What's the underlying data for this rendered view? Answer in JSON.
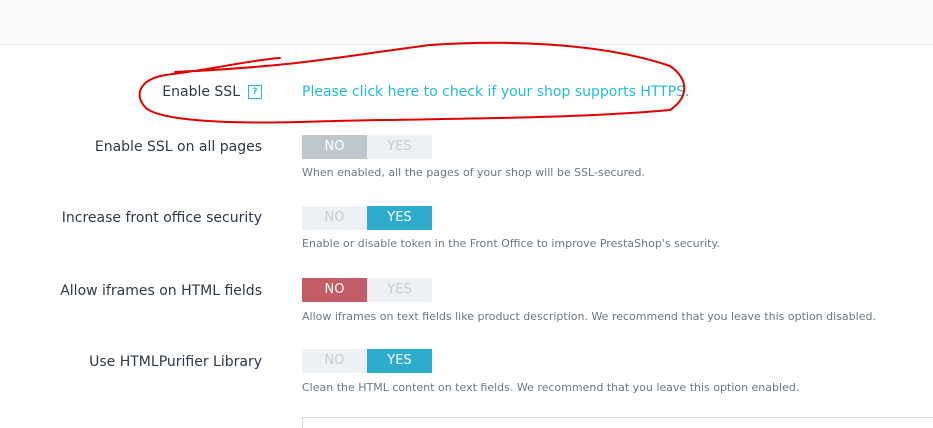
{
  "ssl": {
    "label": "Enable SSL",
    "help_icon": "help-icon",
    "help_glyph": "?",
    "link_text": "Please click here to check if your shop supports HTTPS."
  },
  "rows": [
    {
      "label": "Enable SSL on all pages",
      "no": "NO",
      "yes": "YES",
      "value": "NO",
      "hint": "When enabled, all the pages of your shop will be SSL-secured."
    },
    {
      "label": "Increase front office security",
      "no": "NO",
      "yes": "YES",
      "value": "YES",
      "hint": "Enable or disable token in the Front Office to improve PrestaShop's security."
    },
    {
      "label": "Allow iframes on HTML fields",
      "no": "NO",
      "yes": "YES",
      "value": "NO",
      "hint": "Allow iframes on text fields like product description. We recommend that you leave this option disabled."
    },
    {
      "label": "Use HTMLPurifier Library",
      "no": "NO",
      "yes": "YES",
      "value": "YES",
      "hint": "Clean the HTML content on text fields. We recommend that you leave this option enabled."
    }
  ],
  "colors": {
    "accent": "#25b9d7",
    "active_yes": "#2eacce",
    "active_no_grey": "#bcc8ce",
    "active_no_red": "#c45c67",
    "annotation": "#e00000"
  }
}
